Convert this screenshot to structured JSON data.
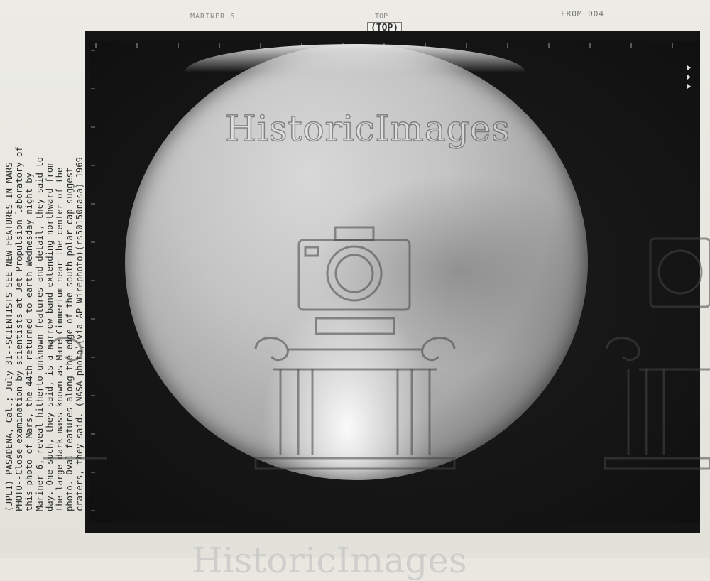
{
  "header": {
    "left_label": "MARINER 6",
    "top_small": "TOP",
    "top_label": "(TOP)",
    "right_label": "FROM 004"
  },
  "watermark": {
    "text": "HistoricImages",
    "bottom_text": "HistoricImages",
    "icon": "camera-column-logo-icon"
  },
  "caption": {
    "lines": [
      "(JPL1) PASADENA, Cal.; July 31--SCIENTISTS SEE NEW FEATURES IN MARS",
      "PHOTO--Close examination by scientists at Jet Propulsion laboratory of",
      "this photo of Mars, the 44th returned to earth Wednesday night by",
      "Mariner 6, reveal hitherto unknown features and detail, they said to-",
      "day. One such, they said, is a narrow band extending northward from",
      "the large dark mass known as Mare Cimmerium near the center of the",
      "photo. Oval features along the edge of the south polar cap suggest",
      "craters, they said. (NASA photo)(via AP Wirephoto)(rs50150nasa) 1969"
    ]
  },
  "colors": {
    "paper": "#e9e7e0",
    "photo_background": "#141414",
    "planet_highlight": "#d8d8d8"
  }
}
